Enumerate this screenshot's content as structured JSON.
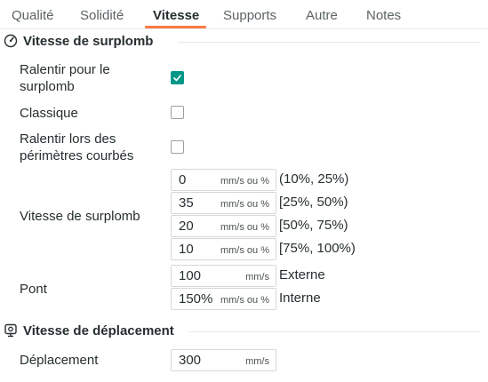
{
  "tabs": [
    {
      "label": "Qualité"
    },
    {
      "label": "Solidité"
    },
    {
      "label": "Vitesse"
    },
    {
      "label": "Supports"
    },
    {
      "label": "Autre"
    },
    {
      "label": "Notes"
    }
  ],
  "active_tab": "Vitesse",
  "accent_color": "#009688",
  "tab_underline_color": "#ff7a45",
  "overhang_section": {
    "title": "Vitesse de surplomb",
    "icon": "speedometer-icon",
    "slow_down_overhang": {
      "label": "Ralentir pour le surplomb",
      "checked": true
    },
    "classic": {
      "label": "Classique",
      "checked": false
    },
    "slow_down_curled": {
      "label": "Ralentir lors des périmètres courbés",
      "checked": false
    },
    "overhang_speed": {
      "label": "Vitesse de surplomb",
      "rows": [
        {
          "value": "0",
          "unit": "mm/s ou %",
          "range": "(10%, 25%)"
        },
        {
          "value": "35",
          "unit": "mm/s ou %",
          "range": "[25%, 50%)"
        },
        {
          "value": "20",
          "unit": "mm/s ou %",
          "range": "[50%, 75%)"
        },
        {
          "value": "10",
          "unit": "mm/s ou %",
          "range": "[75%, 100%)"
        }
      ]
    },
    "bridge": {
      "label": "Pont",
      "rows": [
        {
          "value": "100",
          "unit": "mm/s",
          "side": "Externe"
        },
        {
          "value": "150%",
          "unit": "mm/s ou %",
          "side": "Interne"
        }
      ]
    }
  },
  "travel_section": {
    "title": "Vitesse de déplacement",
    "icon": "travel-icon",
    "travel": {
      "label": "Déplacement",
      "value": "300",
      "unit": "mm/s"
    }
  }
}
